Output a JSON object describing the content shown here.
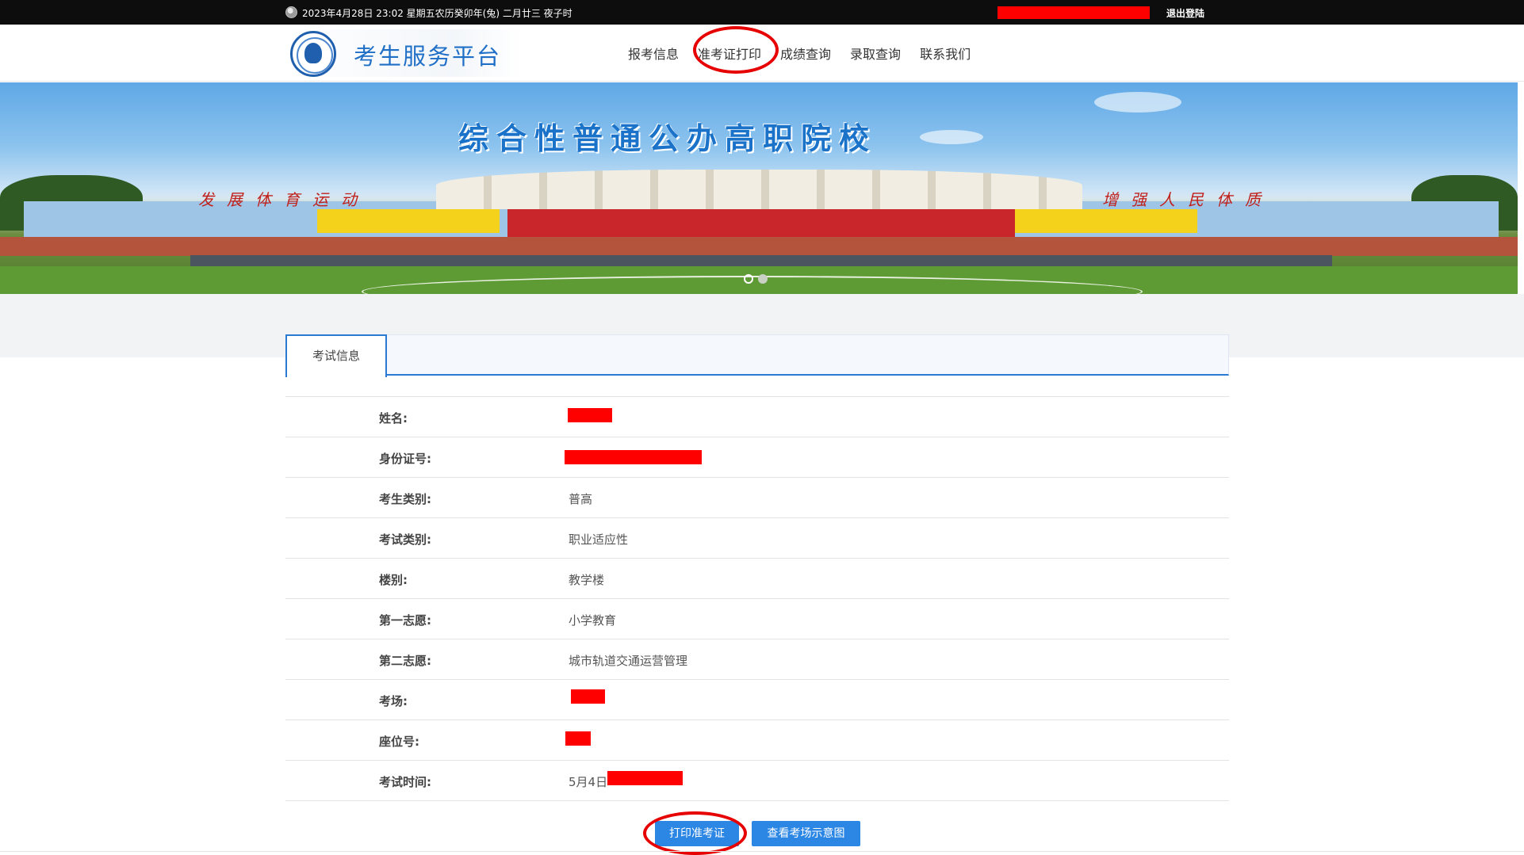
{
  "topbar": {
    "datetime": "2023年4月28日  23:02  星期五农历癸卯年(兔) 二月廿三  夜子时",
    "logout_label": "退出登陆"
  },
  "header": {
    "platform_title": "考生服务平台",
    "nav": [
      "报考信息",
      "准考证打印",
      "成绩查询",
      "录取查询",
      "联系我们"
    ]
  },
  "banner": {
    "slogan": "综合性普通公办高职院校",
    "left_text": "发展体育运动",
    "right_text": "增强人民体质"
  },
  "tabs": {
    "active": "考试信息"
  },
  "info": {
    "rows": [
      {
        "label": "姓名:",
        "value": ""
      },
      {
        "label": "身份证号:",
        "value": ""
      },
      {
        "label": "考生类别:",
        "value": "普高"
      },
      {
        "label": "考试类别:",
        "value": "职业适应性"
      },
      {
        "label": "楼别:",
        "value": "教学楼"
      },
      {
        "label": "第一志愿:",
        "value": "小学教育"
      },
      {
        "label": "第二志愿:",
        "value": "城市轨道交通运营管理"
      },
      {
        "label": "考场:",
        "value": ""
      },
      {
        "label": "座位号:",
        "value": ""
      },
      {
        "label": "考试时间:",
        "value": "5月4日"
      }
    ]
  },
  "buttons": {
    "print_label": "打印准考证",
    "map_label": "查看考场示意图"
  },
  "colors": {
    "primary": "#2b86e4",
    "annotation_red": "#e60000",
    "redaction": "#ff0000",
    "topbar": "#0d0d0d"
  }
}
